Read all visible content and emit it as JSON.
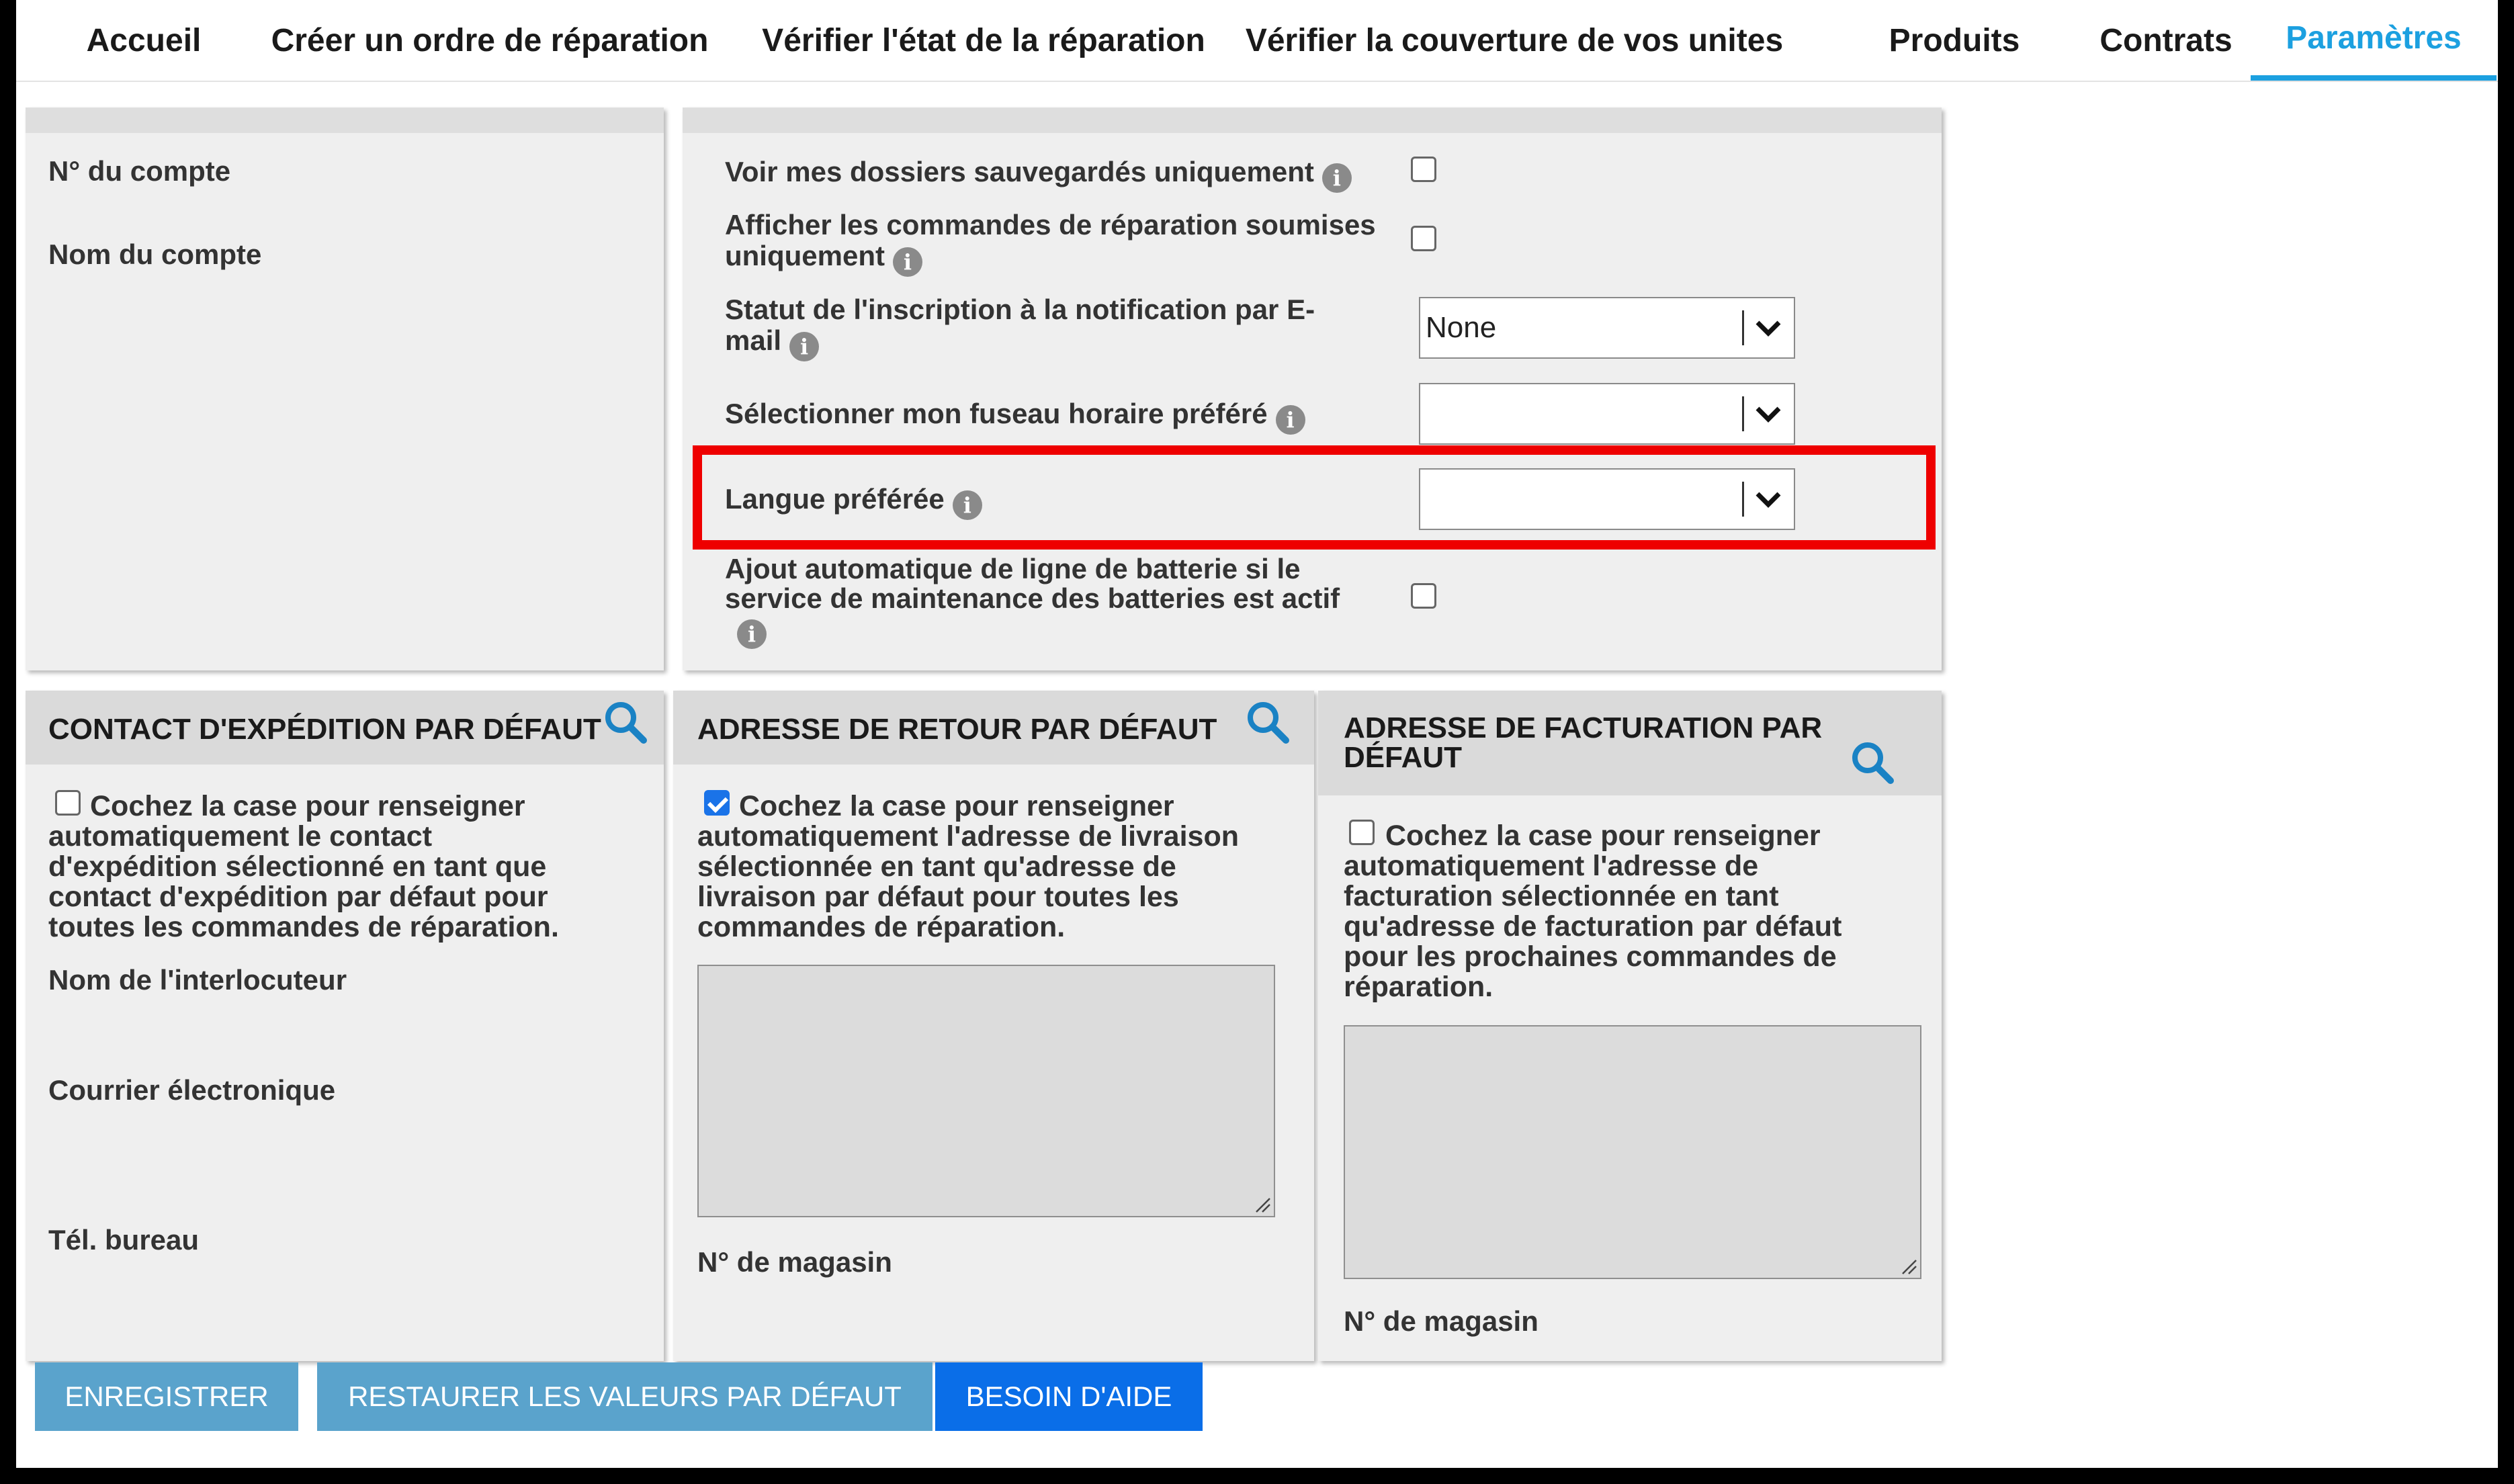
{
  "nav": {
    "tabs": [
      {
        "label": "Accueil"
      },
      {
        "label": "Créer un ordre de réparation"
      },
      {
        "label": "Vérifier l'état de la réparation"
      },
      {
        "label": "Vérifier la couverture de vos unites"
      },
      {
        "label": "Produits"
      },
      {
        "label": "Contrats"
      },
      {
        "label": "Paramètres",
        "active": true
      }
    ],
    "active_color": "#1ca0e0"
  },
  "account": {
    "number_label": "N° du compte",
    "name_label": "Nom du compte"
  },
  "preferences": {
    "saved_only_label": "Voir mes dossiers sauvegardés uniquement",
    "saved_only_checked": false,
    "submitted_only_line1": "Afficher les commandes de réparation soumises",
    "submitted_only_line2": "uniquement",
    "submitted_only_checked": false,
    "email_status_line1": "Statut de l'inscription à la notification par E-",
    "email_status_line2": "mail",
    "email_status_value": "None",
    "timezone_label": "Sélectionner mon fuseau horaire préféré",
    "timezone_value": "",
    "language_label": "Langue préférée",
    "language_value": "",
    "battery_line1": "Ajout automatique de ligne de batterie si le",
    "battery_line2": "service de maintenance des batteries est actif",
    "battery_checked": false,
    "info_icon_glyph": "i",
    "highlight_color": "#ee0000"
  },
  "shipping": {
    "title": "CONTACT D'EXPÉDITION PAR DÉFAUT",
    "checkbox_checked": false,
    "text_lines": [
      "Cochez la case pour renseigner",
      "automatiquement le contact",
      "d'expédition sélectionné en tant que",
      "contact d'expédition par défaut pour",
      "toutes les commandes de réparation."
    ],
    "contact_name_label": "Nom de l'interlocuteur",
    "email_label": "Courrier électronique",
    "phone_label": "Tél. bureau"
  },
  "return": {
    "title": "ADRESSE DE RETOUR PAR DÉFAUT",
    "checkbox_checked": true,
    "text_lines": [
      "Cochez la case pour renseigner",
      "automatiquement l'adresse de livraison",
      "sélectionnée en tant qu'adresse de",
      "livraison par défaut pour toutes les",
      "commandes de réparation."
    ],
    "address_value": "",
    "store_label": "N° de magasin"
  },
  "billing": {
    "title_line1": "ADRESSE DE FACTURATION PAR",
    "title_line2": "DÉFAUT",
    "checkbox_checked": false,
    "text_lines": [
      "Cochez la case pour renseigner",
      "automatiquement l'adresse de",
      "facturation sélectionnée en tant",
      "qu'adresse de facturation par défaut",
      "pour les prochaines commandes de",
      "réparation."
    ],
    "address_value": "",
    "store_label": "N° de magasin"
  },
  "actions": {
    "save": "ENREGISTRER",
    "restore": "RESTAURER LES VALEURS PAR DÉFAUT",
    "help": "BESOIN D'AIDE",
    "secondary_color": "#5aa3cc",
    "primary_color": "#0a6ee8"
  }
}
